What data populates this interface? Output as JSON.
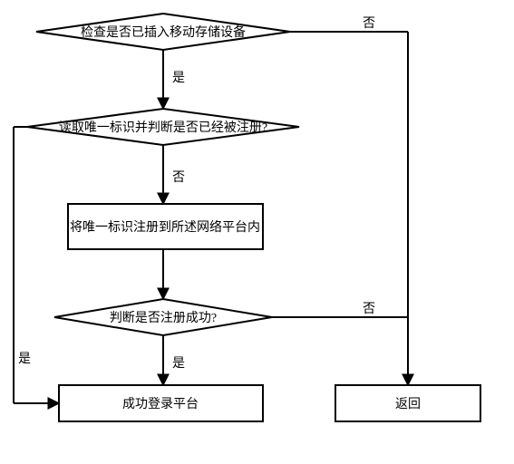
{
  "flow": {
    "d1": {
      "label": "检查是否已插入移动存储设备"
    },
    "d2": {
      "label": "读取唯一标识并判断是否已经被注册?"
    },
    "p1": {
      "label": "将唯一标识注册到所述网络平台内"
    },
    "d3": {
      "label": "判断是否注册成功?"
    },
    "t_success": {
      "label": "成功登录平台"
    },
    "t_return": {
      "label": "返回"
    }
  },
  "edges": {
    "yes": "是",
    "no": "否"
  }
}
